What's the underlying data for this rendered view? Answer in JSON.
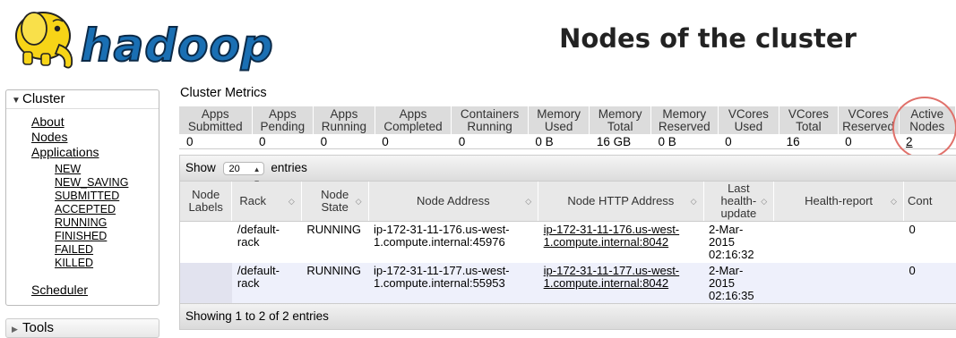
{
  "header": {
    "logo_text": "hadoop",
    "logo_icon": "elephant-icon",
    "title": "Nodes of the cluster"
  },
  "sidebar": {
    "cluster_label": "Cluster",
    "cluster_items": [
      "About",
      "Nodes",
      "Applications"
    ],
    "app_states": [
      "NEW",
      "NEW_SAVING",
      "SUBMITTED",
      "ACCEPTED",
      "RUNNING",
      "FINISHED",
      "FAILED",
      "KILLED"
    ],
    "scheduler_label": "Scheduler",
    "tools_label": "Tools"
  },
  "metrics": {
    "title": "Cluster Metrics",
    "headers": [
      [
        "Apps",
        "Submitted"
      ],
      [
        "Apps",
        "Pending"
      ],
      [
        "Apps",
        "Running"
      ],
      [
        "Apps",
        "Completed"
      ],
      [
        "Containers",
        "Running"
      ],
      [
        "Memory",
        "Used"
      ],
      [
        "Memory",
        "Total"
      ],
      [
        "Memory",
        "Reserved"
      ],
      [
        "VCores",
        "Used"
      ],
      [
        "VCores",
        "Total"
      ],
      [
        "VCores",
        "Reserved"
      ],
      [
        "Active",
        "Nodes"
      ]
    ],
    "values": [
      "0",
      "0",
      "0",
      "0",
      "0",
      "0 B",
      "16 GB",
      "0 B",
      "0",
      "16",
      "0",
      "2"
    ]
  },
  "nodes_table": {
    "show_label": "Show",
    "page_size": "20",
    "entries_label": "entries",
    "columns": [
      [
        "Node",
        "Labels"
      ],
      [
        "Rack"
      ],
      [
        "Node",
        "State"
      ],
      [
        "Node Address"
      ],
      [
        "Node HTTP Address"
      ],
      [
        "Last",
        "health-",
        "update"
      ],
      [
        "Health-report"
      ],
      [
        "Cont"
      ]
    ],
    "rows": [
      {
        "labels": "",
        "rack": [
          "/default-",
          "rack"
        ],
        "state": "RUNNING",
        "address": [
          "ip-172-31-11-176.us-west-",
          "1.compute.internal:45976"
        ],
        "http_address": [
          "ip-172-31-11-176.us-west-",
          "1.compute.internal:8042"
        ],
        "last_update": [
          "2-Mar-",
          "2015",
          "02:16:32"
        ],
        "health_report": "",
        "containers": "0"
      },
      {
        "labels": "",
        "rack": [
          "/default-",
          "rack"
        ],
        "state": "RUNNING",
        "address": [
          "ip-172-31-11-177.us-west-",
          "1.compute.internal:55953"
        ],
        "http_address": [
          "ip-172-31-11-177.us-west-",
          "1.compute.internal:8042"
        ],
        "last_update": [
          "2-Mar-",
          "2015",
          "02:16:35"
        ],
        "health_report": "",
        "containers": "0"
      }
    ],
    "footer": "Showing 1 to 2 of 2 entries"
  },
  "colors": {
    "header_gray": "#dcdcdc",
    "row_alt": "#eef0fb",
    "highlight_circle": "#e0706a",
    "logo_blue": "#1a6fb3",
    "elephant_yellow": "#f7d417"
  }
}
